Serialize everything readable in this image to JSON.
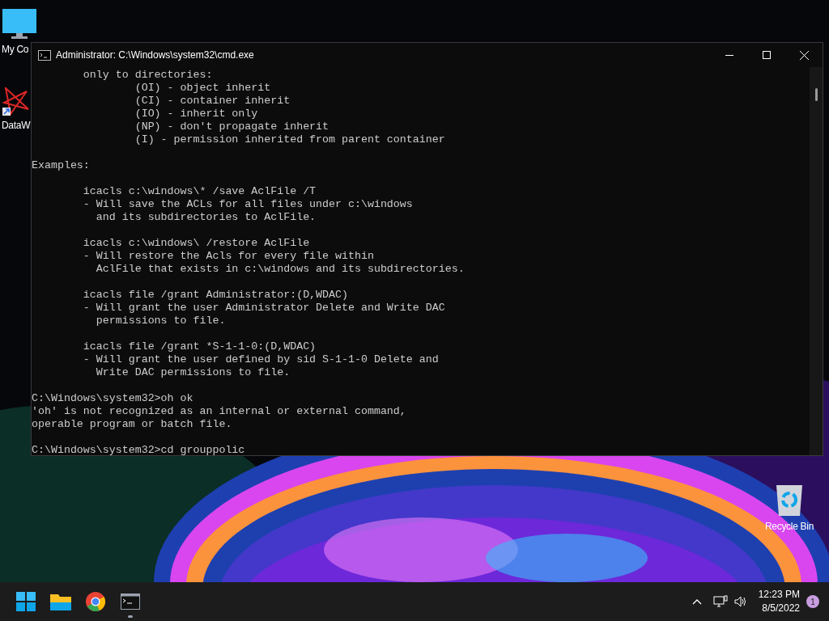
{
  "desktop_icons": [
    {
      "kind": "computer",
      "label": "My Co"
    },
    {
      "kind": "shortcut",
      "label": "DataW"
    },
    {
      "kind": "recycle",
      "label": "Recycle Bin"
    }
  ],
  "window": {
    "title": "Administrator: C:\\Windows\\system32\\cmd.exe",
    "console_blocks": [
      [
        "        only to directories:",
        "                (OI) - object inherit",
        "                (CI) - container inherit",
        "                (IO) - inherit only",
        "                (NP) - don't propagate inherit",
        "                (I) - permission inherited from parent container"
      ],
      [
        "Examples:"
      ],
      [
        "        icacls c:\\windows\\* /save AclFile /T",
        "        - Will save the ACLs for all files under c:\\windows",
        "          and its subdirectories to AclFile."
      ],
      [
        "        icacls c:\\windows\\ /restore AclFile",
        "        - Will restore the Acls for every file within",
        "          AclFile that exists in c:\\windows and its subdirectories."
      ],
      [
        "        icacls file /grant Administrator:(D,WDAC)",
        "        - Will grant the user Administrator Delete and Write DAC",
        "          permissions to file."
      ],
      [
        "        icacls file /grant *S-1-1-0:(D,WDAC)",
        "        - Will grant the user defined by sid S-1-1-0 Delete and",
        "          Write DAC permissions to file."
      ],
      [
        "C:\\Windows\\system32>oh ok",
        "'oh' is not recognized as an internal or external command,",
        "operable program or batch file."
      ],
      [
        "C:\\Windows\\system32>cd grouppolic"
      ]
    ]
  },
  "taskbar": {
    "apps": [
      {
        "kind": "start",
        "running": false
      },
      {
        "kind": "folder",
        "running": false
      },
      {
        "kind": "browser",
        "running": false
      },
      {
        "kind": "terminal",
        "running": true
      }
    ],
    "clock": {
      "time": "12:23 PM",
      "date": "8/5/2022"
    },
    "notification_count": "1"
  }
}
